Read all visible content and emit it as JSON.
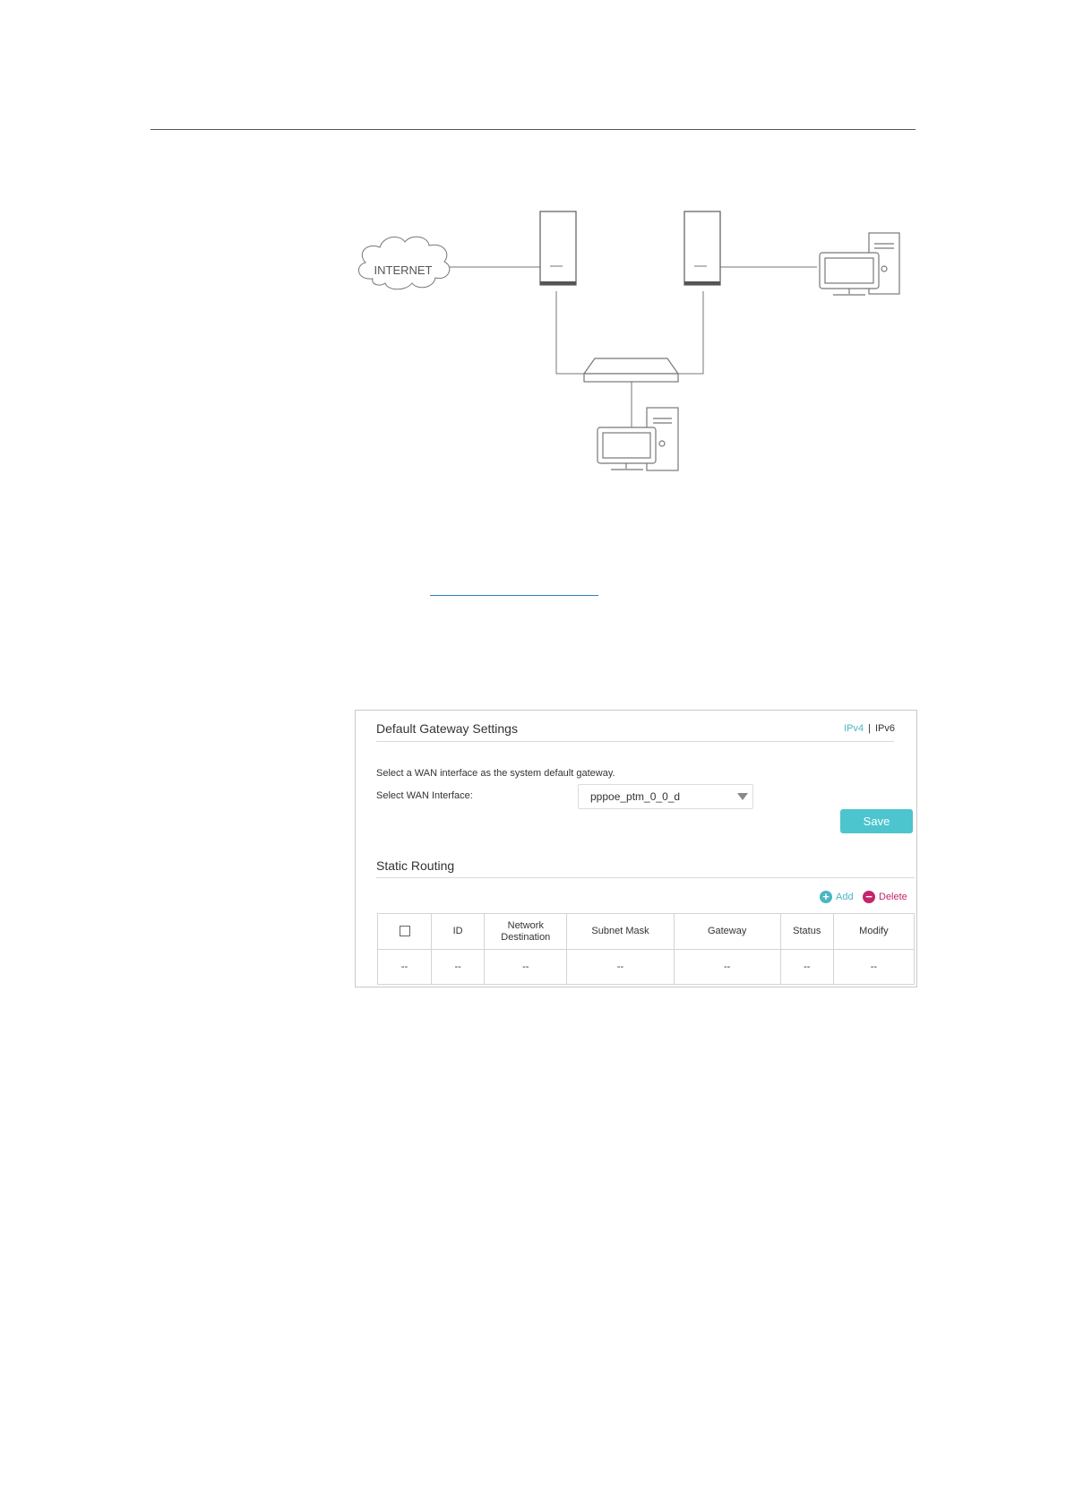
{
  "diagram": {
    "internet_label": "INTERNET"
  },
  "panel": {
    "title": "Default Gateway Settings",
    "ipv4_tab": "IPv4",
    "separator": "|",
    "ipv6_tab": "IPv6",
    "instruction": "Select a WAN interface as the system default gateway.",
    "wan_label": "Select WAN Interface:",
    "wan_value": "pppoe_ptm_0_0_d",
    "save_label": "Save"
  },
  "static_routing": {
    "title": "Static Routing",
    "add_label": "Add",
    "delete_label": "Delete",
    "columns": [
      "ID",
      "Network Destination",
      "Subnet Mask",
      "Gateway",
      "Status",
      "Modify"
    ],
    "row": [
      "--",
      "--",
      "--",
      "--",
      "--",
      "--",
      "--"
    ]
  },
  "colors": {
    "accent": "#4cc5cf",
    "delete": "#c4256b"
  }
}
